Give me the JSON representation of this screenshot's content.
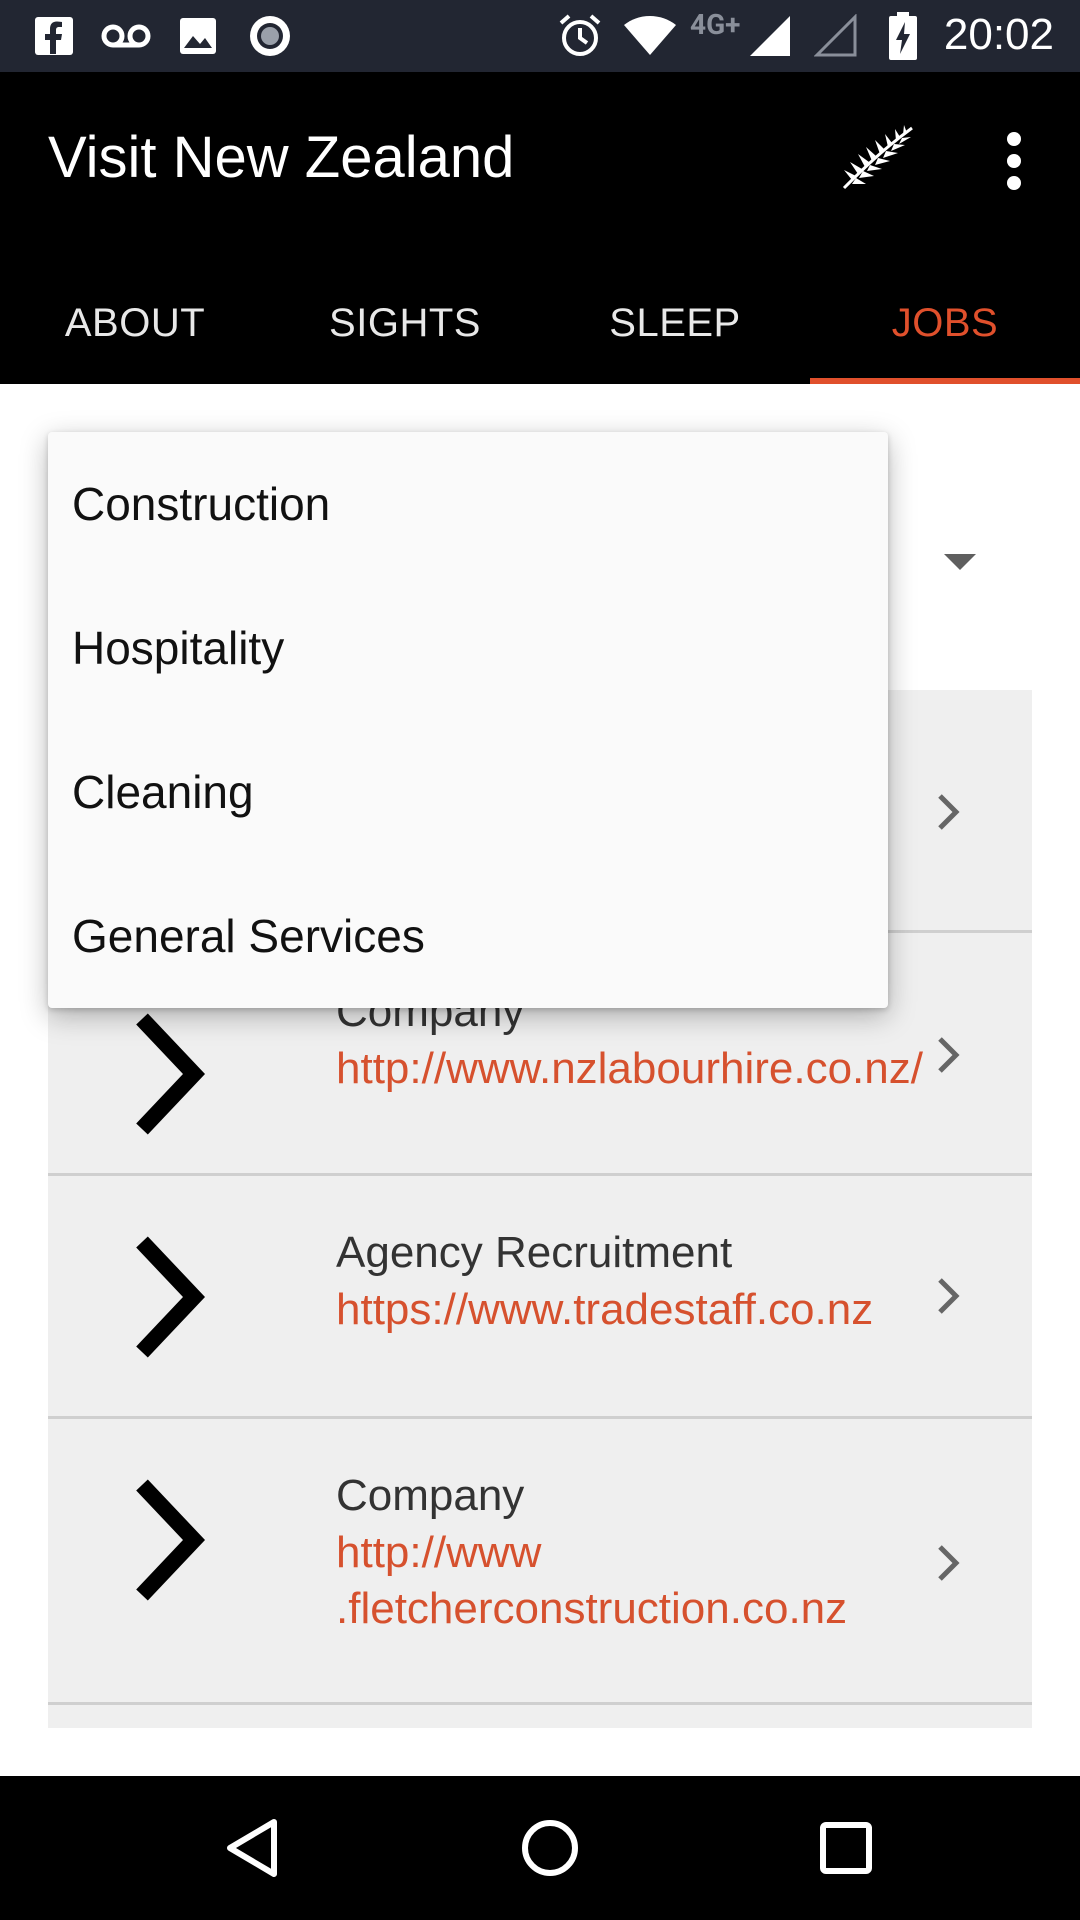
{
  "status_bar": {
    "time": "20:02",
    "network_label": "4G+",
    "icons": [
      "facebook-icon",
      "voicemail-icon",
      "image-icon",
      "record-icon",
      "alarm-icon",
      "wifi-icon",
      "signal-icon",
      "signal-empty-icon",
      "battery-charging-icon"
    ]
  },
  "app_bar": {
    "title": "Visit New Zealand",
    "icons": [
      "fern-icon",
      "overflow-menu-icon"
    ]
  },
  "tabs": [
    {
      "label": "ABOUT",
      "active": false
    },
    {
      "label": "SIGHTS",
      "active": false
    },
    {
      "label": "SLEEP",
      "active": false
    },
    {
      "label": "JOBS",
      "active": true
    }
  ],
  "colors": {
    "accent": "#e0502c",
    "app_bar": "#000000",
    "status_bar": "#222632",
    "list_bg": "#efefef",
    "link": "#d6512e"
  },
  "dropdown": {
    "options": [
      "Construction",
      "Hospitality",
      "Cleaning",
      "General Services"
    ]
  },
  "list": {
    "rows": [
      {
        "title": "",
        "link": ""
      },
      {
        "title": "Company",
        "link": "http://www.nzlabourhire.co.nz/"
      },
      {
        "title": "Agency Recruitment",
        "link": "https://www.tradestaff.co.nz"
      },
      {
        "title": "Company",
        "link_line1": "http://www",
        "link_line2": ".fletcherconstruction.co.nz"
      }
    ]
  },
  "nav_bar": {
    "icons": [
      "back-icon",
      "home-icon",
      "recents-icon"
    ]
  }
}
